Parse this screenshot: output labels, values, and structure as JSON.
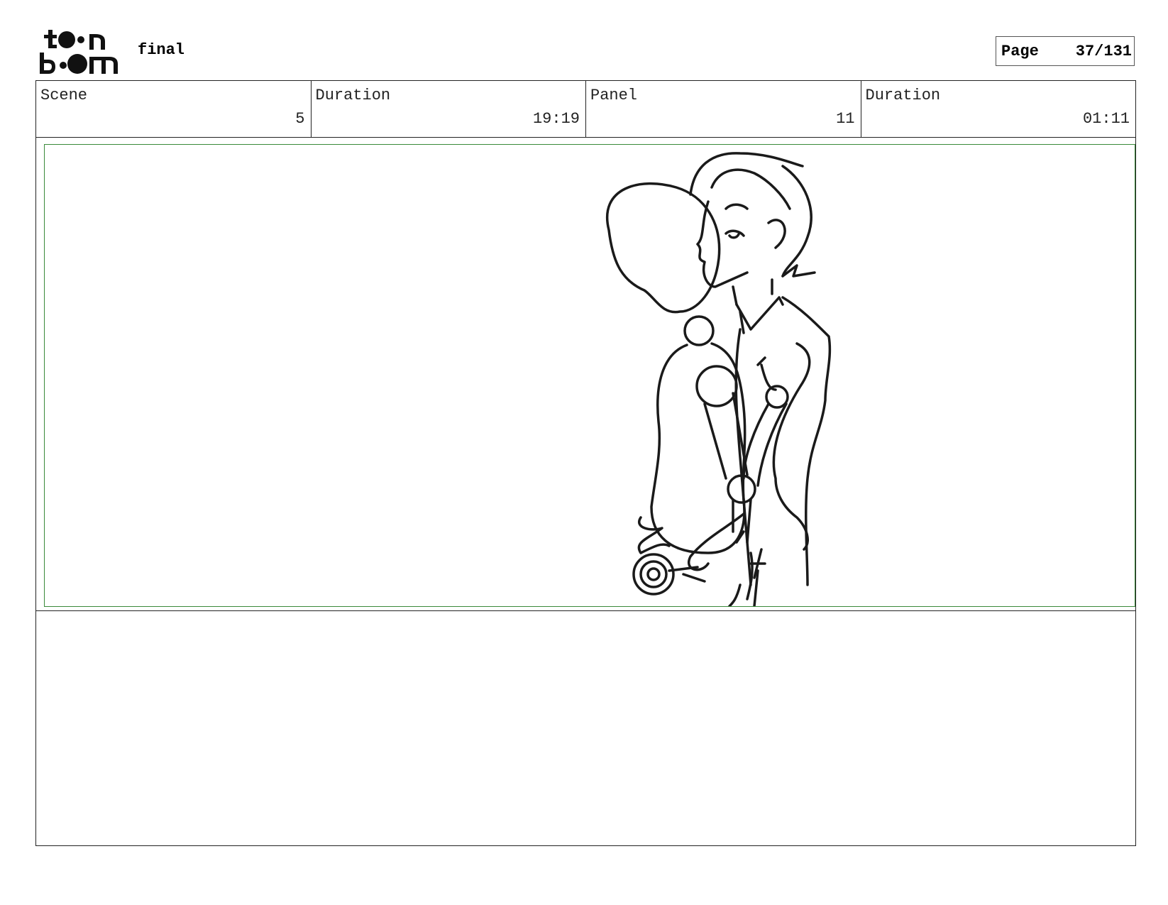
{
  "header": {
    "logo_alt": "toon boom",
    "project_title": "final",
    "page_label": "Page",
    "page_value": "37/131"
  },
  "info": {
    "scene_label": "Scene",
    "scene_value": "5",
    "scene_duration_label": "Duration",
    "scene_duration_value": "19:19",
    "panel_label": "Panel",
    "panel_value": "11",
    "panel_duration_label": "Duration",
    "panel_duration_value": "01:11"
  },
  "panel": {
    "safe_area_color": "#3a8a3a"
  },
  "notes": {
    "text": ""
  }
}
